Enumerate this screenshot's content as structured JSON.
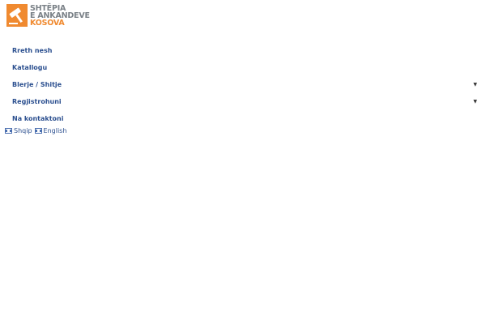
{
  "brand": {
    "line1": "SHTËPIA",
    "line2": "E ANKANDEVE",
    "line3": "KOSOVA",
    "colors": {
      "accent": "#f08a30",
      "grey": "#7a8187",
      "link": "#2b4f8f"
    }
  },
  "nav": {
    "items": [
      {
        "label": "Rreth nesh",
        "dropdown": false
      },
      {
        "label": "Katallogu",
        "dropdown": false
      },
      {
        "label": "Blerje / Shitje",
        "dropdown": true,
        "icon": "chevron-down-icon"
      },
      {
        "label": "Regjistrohuni",
        "dropdown": true,
        "icon": "chevron-down-icon"
      },
      {
        "label": "Na kontaktoni",
        "dropdown": false
      }
    ]
  },
  "languages": [
    {
      "label": "Shqip",
      "icon": "flag-icon"
    },
    {
      "label": "English",
      "icon": "flag-icon"
    }
  ]
}
